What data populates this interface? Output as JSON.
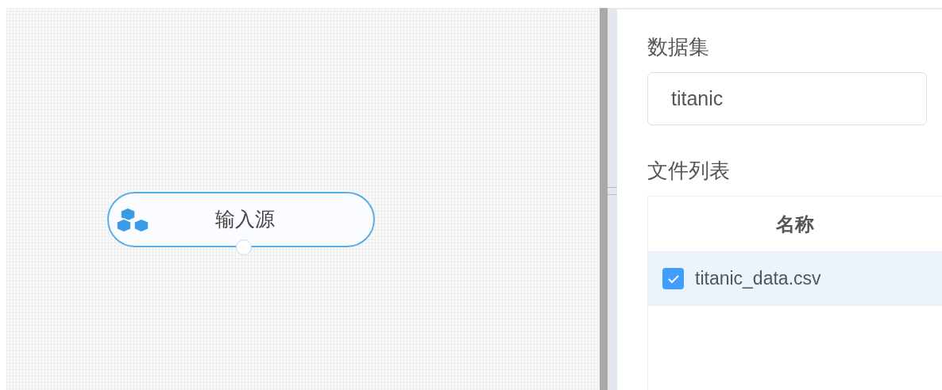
{
  "canvas": {
    "nodes": [
      {
        "label": "输入源",
        "selected": true
      }
    ]
  },
  "panel": {
    "dataset": {
      "label": "数据集",
      "value": "titanic"
    },
    "file_list": {
      "label": "文件列表",
      "columns": [
        "名称"
      ],
      "rows": [
        {
          "name": "titanic_data.csv",
          "checked": true,
          "selected": true
        }
      ]
    }
  }
}
